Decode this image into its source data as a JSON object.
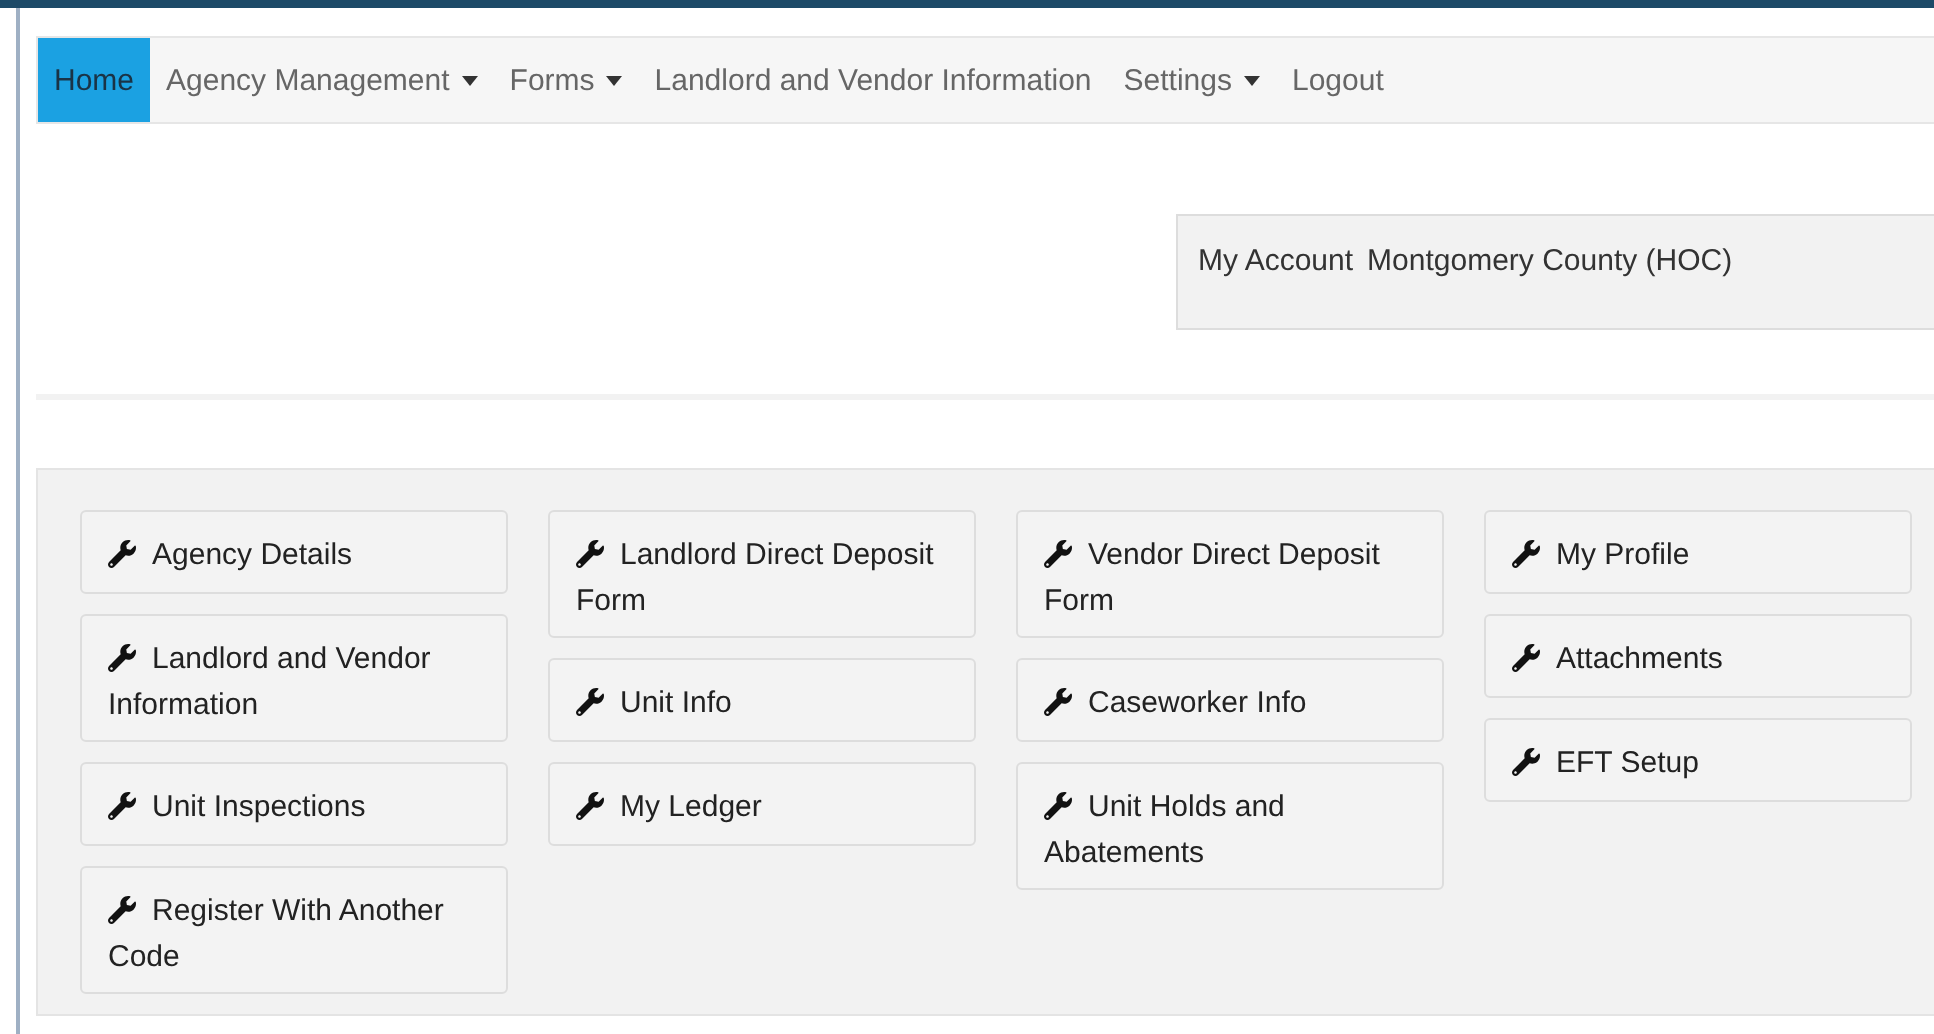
{
  "nav": [
    {
      "label": "Home",
      "selected": true,
      "dropdown": false
    },
    {
      "label": "Agency Management",
      "selected": false,
      "dropdown": true
    },
    {
      "label": "Forms",
      "selected": false,
      "dropdown": true
    },
    {
      "label": "Landlord and Vendor Information",
      "selected": false,
      "dropdown": false
    },
    {
      "label": "Settings",
      "selected": false,
      "dropdown": true
    },
    {
      "label": "Logout",
      "selected": false,
      "dropdown": false
    }
  ],
  "account": {
    "label": "My Account",
    "value": "Montgomery County (HOC)"
  },
  "tile_columns": [
    [
      "Agency Details",
      "Landlord and Vendor Information",
      "Unit Inspections",
      "Register With Another Code"
    ],
    [
      "Landlord Direct Deposit Form",
      "Unit Info",
      "My Ledger"
    ],
    [
      "Vendor Direct Deposit Form",
      "Caseworker Info",
      "Unit Holds and Abatements"
    ],
    [
      "My Profile",
      "Attachments",
      "EFT Setup"
    ]
  ]
}
